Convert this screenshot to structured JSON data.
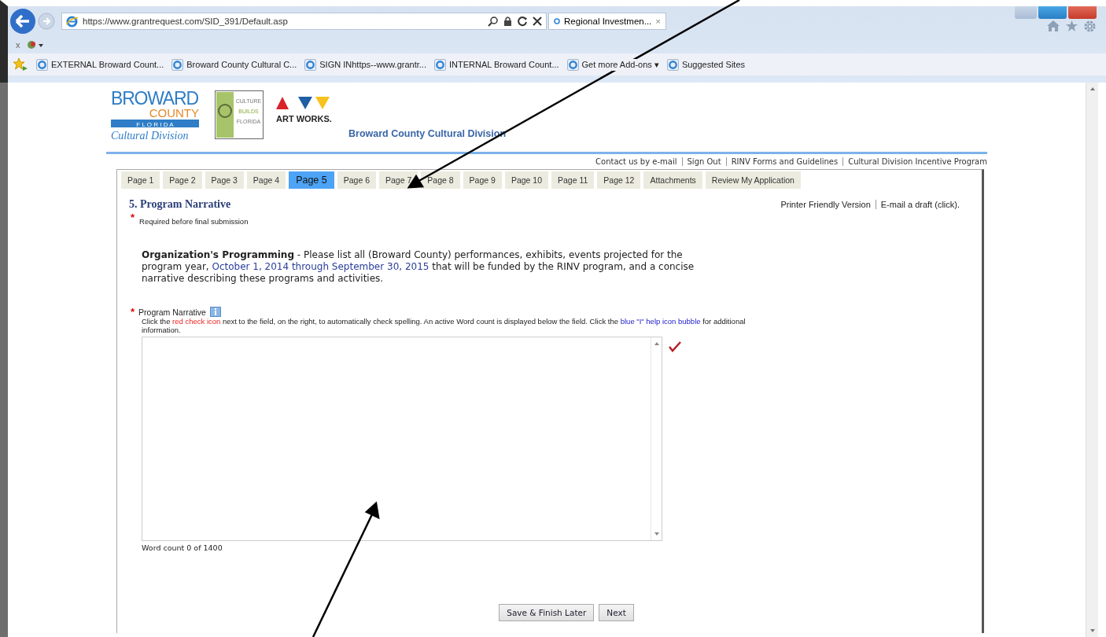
{
  "browser": {
    "address": "https://www.grantrequest.com/SID_391/Default.asp",
    "tab": {
      "title": "Regional Investmen...",
      "close": "×",
      "selected": true
    },
    "command_row": "x",
    "favorites": [
      {
        "label": "EXTERNAL Broward Count..."
      },
      {
        "label": "Broward County Cultural C..."
      },
      {
        "label": "SIGN INhttps--www.grantr..."
      },
      {
        "label": "INTERNAL Broward Count..."
      },
      {
        "label": "Get more Add-ons ▾"
      },
      {
        "label": "Suggested Sites"
      }
    ]
  },
  "logos": {
    "broward": {
      "name": "BROWARD",
      "county": "COUNTY",
      "state": "F L O R I D A",
      "division": "Cultural Division"
    },
    "culture": [
      "CULTURE",
      "BUILDS",
      "FLORIDA"
    ],
    "artworks": "ART WORKS."
  },
  "site_title": "Broward County Cultural Division",
  "top_links": [
    "Contact us by e-mail",
    "Sign Out",
    "RINV Forms and Guidelines",
    "Cultural Division Incentive Program"
  ],
  "tabs": [
    {
      "label": "Page 1",
      "selected": false
    },
    {
      "label": "Page 2",
      "selected": false
    },
    {
      "label": "Page 3",
      "selected": false
    },
    {
      "label": "Page 4",
      "selected": false
    },
    {
      "label": "Page 5",
      "selected": true
    },
    {
      "label": "Page 6",
      "selected": false
    },
    {
      "label": "Page 7",
      "selected": false
    },
    {
      "label": "Page 8",
      "selected": false
    },
    {
      "label": "Page 9",
      "selected": false
    },
    {
      "label": "Page 10",
      "selected": false
    },
    {
      "label": "Page 11",
      "selected": false
    },
    {
      "label": "Page 12",
      "selected": false
    },
    {
      "label": "Attachments",
      "selected": false
    },
    {
      "label": "Review My Application",
      "selected": false
    }
  ],
  "section_title": "5. Program Narrative",
  "side_links": [
    "Printer Friendly Version",
    "E-mail a draft (click)."
  ],
  "required_mark": "*",
  "required_note": "Required before final submission",
  "intro": [
    {
      "kind": "bold",
      "text": "Organization's Programming"
    },
    {
      "kind": "plain",
      "text": " - Please list all (Broward County) performances, exhibits, events projected for the program year, "
    },
    {
      "kind": "date",
      "text": "October 1, 2014 through September 30, 2015"
    },
    {
      "kind": "plain",
      "text": " that will be funded by the RINV program, and a concise narrative describing these programs and activities."
    }
  ],
  "field": {
    "label": "Program Narrative",
    "required": true,
    "help": [
      {
        "kind": "plain",
        "text": "Click the "
      },
      {
        "kind": "red",
        "text": "red check icon"
      },
      {
        "kind": "plain",
        "text": " next to the field, on the right, to automatically check spelling. An active Word count is displayed below the field. Click the "
      },
      {
        "kind": "blue",
        "text": "blue \"I\" help icon bubble"
      },
      {
        "kind": "plain",
        "text": " for additional information."
      }
    ],
    "word_count": "Word count 0 of 1400"
  },
  "buttons": [
    "Save & Finish Later",
    "Next"
  ]
}
